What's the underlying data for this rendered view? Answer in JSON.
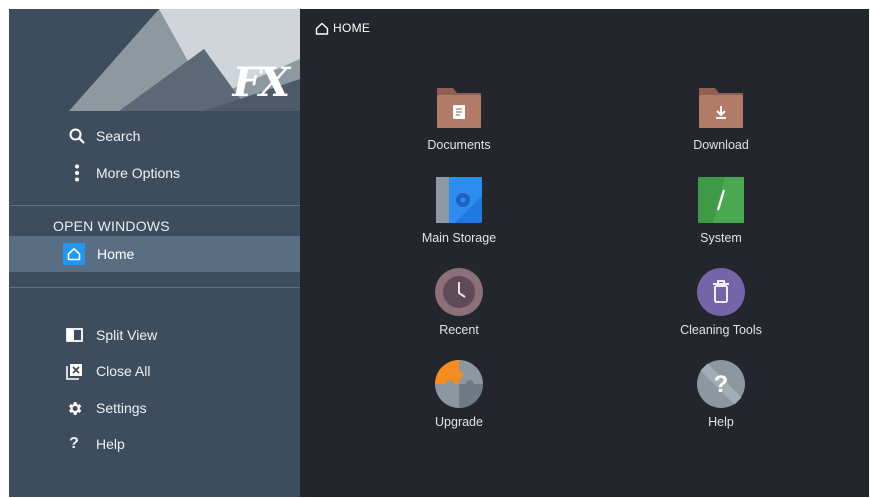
{
  "sidebar": {
    "logo": "FX",
    "top_items": [
      {
        "label": "Search",
        "icon": "search-icon"
      },
      {
        "label": "More Options",
        "icon": "more-vertical-icon"
      }
    ],
    "open_windows_title": "OPEN WINDOWS",
    "open_window": {
      "label": "Home",
      "icon": "home-icon"
    },
    "bottom_items": [
      {
        "label": "Split View",
        "icon": "split-view-icon"
      },
      {
        "label": "Close All",
        "icon": "close-all-icon"
      },
      {
        "label": "Settings",
        "icon": "gear-icon"
      },
      {
        "label": "Help",
        "icon": "question-icon"
      }
    ]
  },
  "main": {
    "breadcrumb": "HOME",
    "tiles": [
      {
        "label": "Documents",
        "icon": "folder-documents-icon"
      },
      {
        "label": "Download",
        "icon": "folder-download-icon"
      },
      {
        "label": "Main Storage",
        "icon": "storage-icon"
      },
      {
        "label": "System",
        "icon": "system-icon"
      },
      {
        "label": "Recent",
        "icon": "clock-icon"
      },
      {
        "label": "Cleaning Tools",
        "icon": "trash-icon"
      },
      {
        "label": "Upgrade",
        "icon": "puzzle-icon"
      },
      {
        "label": "Help",
        "icon": "help-icon"
      }
    ]
  },
  "colors": {
    "sidebar_bg": "#3e4d5e",
    "main_bg": "#23272d",
    "selected_bg": "#5a6e83",
    "accent": "#2196f3",
    "folder": "#b27b67",
    "system_green": "#3f9a46",
    "cleaning_purple": "#7565a8",
    "upgrade_orange": "#f48c1e"
  }
}
